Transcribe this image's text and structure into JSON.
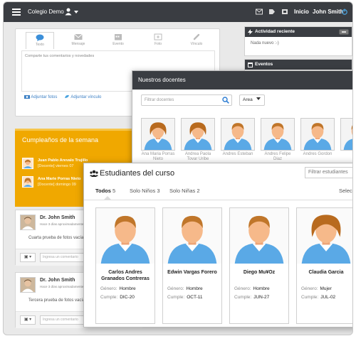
{
  "topbar": {
    "title": "Colegio Demo",
    "home": "Inicio",
    "user": "John Smith"
  },
  "composer": {
    "tabs": [
      "Texto",
      "Mensaje",
      "Evento",
      "Foto",
      "Vínculo"
    ],
    "placeholder": "Comparte tus comentarios y novedades",
    "attach_photos": "Adjuntar fotos",
    "attach_link": "Adjuntar vínculo"
  },
  "birthdays": {
    "title": "Cumpleaños de la semana",
    "people": [
      {
        "name": "Juan Pablo Arevalo Trujillo",
        "sub": "[Docente] viernes 07"
      },
      {
        "name": "Ana Marie Porras Nieto",
        "sub": "[Docente] domingo 09"
      }
    ]
  },
  "posts": [
    {
      "author": "Dr. John Smith",
      "time": "Hace 3 días aproximadamente",
      "text": "Cuarta prueba de fotos vacías",
      "comment_placeholder": "Ingresa un comentario"
    },
    {
      "author": "Dr. John Smith",
      "time": "Hace 3 días aproximadamente",
      "text": "Tercera prueba de fotos vacías",
      "comment_placeholder": "Ingresa un comentario"
    }
  ],
  "activity": {
    "title": "Actividad reciente",
    "empty": "Nada nuevo :-)"
  },
  "events": {
    "title": "Eventos"
  },
  "teachers": {
    "title": "Nuestros docentes",
    "filter_placeholder": "Filtrar docentes",
    "area_label": "Area",
    "items": [
      {
        "name": "Ana Maria Porras Nieto",
        "gender": "f"
      },
      {
        "name": "Andrea Paola Tovar Uribe",
        "gender": "f"
      },
      {
        "name": "Andres Esteban",
        "gender": "m"
      },
      {
        "name": "Andres Felipe Diaz",
        "gender": "m"
      },
      {
        "name": "Andres Gordon",
        "gender": "m"
      },
      {
        "name": "",
        "gender": "m"
      }
    ]
  },
  "students": {
    "title": "Estudiantes del curso",
    "filter_placeholder": "Filtrar estudiantes",
    "select_label": "Selec",
    "tabs": [
      {
        "label": "Todos",
        "count": "5"
      },
      {
        "label": "Solo Niños",
        "count": "3"
      },
      {
        "label": "Solo Niñas",
        "count": "2"
      }
    ],
    "field_gender": "Género:",
    "field_bday": "Cumple:",
    "items": [
      {
        "name": "Carlos Andres Granados Contreras",
        "gender": "Hombre",
        "bday": "DIC-20",
        "sex": "m"
      },
      {
        "name": "Edwin Vargas Forero",
        "gender": "Hombre",
        "bday": "OCT-11",
        "sex": "m"
      },
      {
        "name": "Diego Mu¥Oz",
        "gender": "Hombre",
        "bday": "JUN-27",
        "sex": "m"
      },
      {
        "name": "Claudia Garcia",
        "gender": "Mujer",
        "bday": "JUL-02",
        "sex": "f"
      }
    ]
  },
  "colors": {
    "topbar": "#3a3d42",
    "birthday": "#f0a800",
    "link": "#3b7fc4",
    "avatar_skin": "#f6b98a",
    "avatar_shirt": "#5aa9e6"
  }
}
